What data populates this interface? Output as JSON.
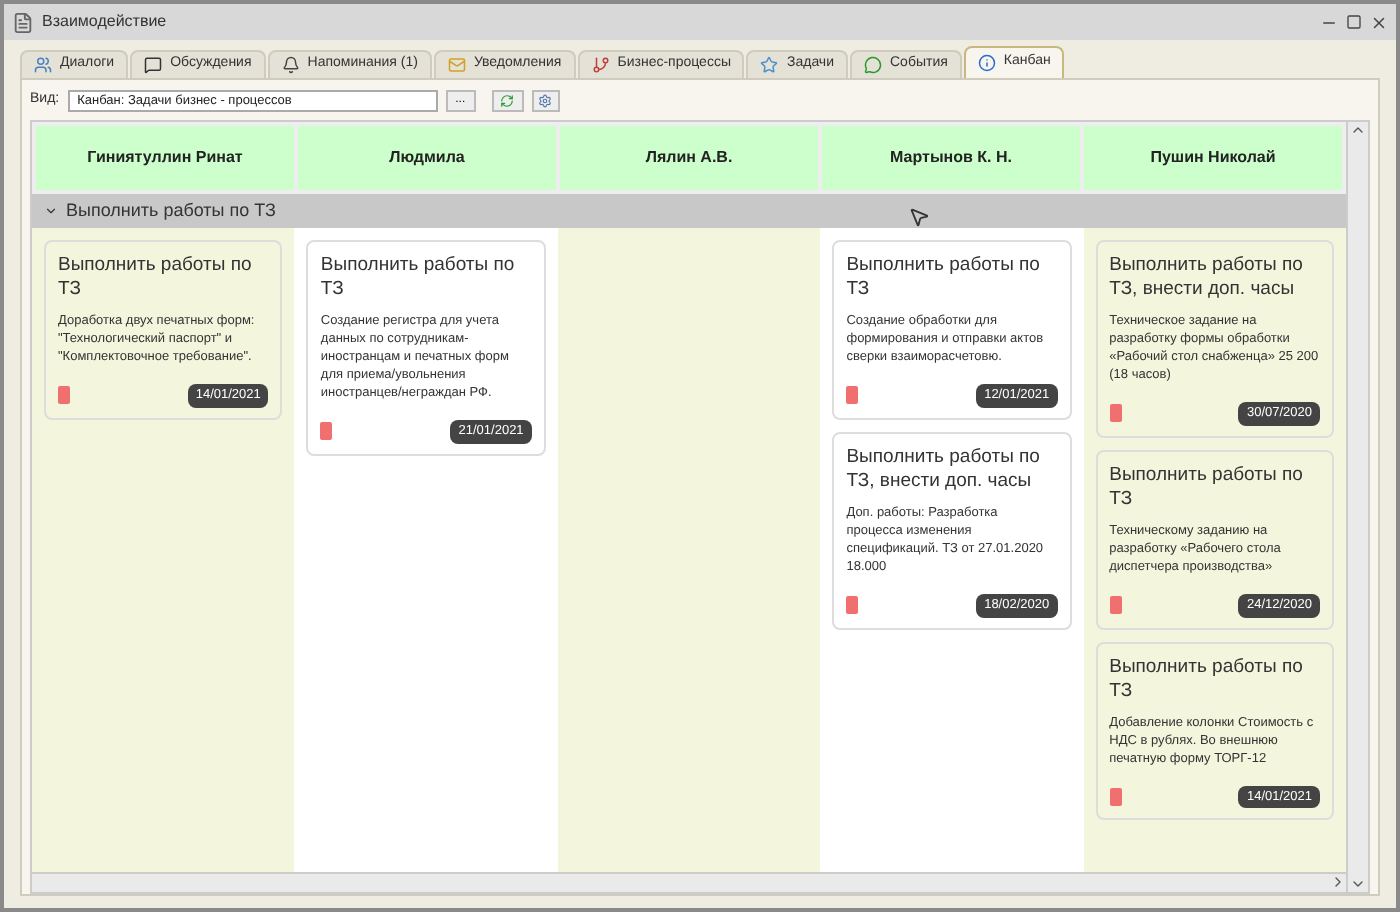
{
  "window": {
    "title": "Взаимодействие"
  },
  "tabs": [
    {
      "label": "Диалоги",
      "selected": false
    },
    {
      "label": "Обсуждения",
      "selected": false
    },
    {
      "label": "Напоминания (1)",
      "selected": false
    },
    {
      "label": "Уведомления",
      "selected": false
    },
    {
      "label": "Бизнес-процессы",
      "selected": false
    },
    {
      "label": "Задачи",
      "selected": false
    },
    {
      "label": "События",
      "selected": false
    },
    {
      "label": "Канбан",
      "selected": true
    }
  ],
  "view": {
    "label": "Вид:",
    "value": "Канбан: Задачи бизнес - процессов",
    "select_button": "..."
  },
  "board": {
    "columns": [
      {
        "name": "Гиниятуллин Ринат",
        "cards": [
          {
            "title": "Выполнить работы по ТЗ",
            "description": "Доработка двух печатных форм: \"Технологический паспорт\" и \"Комплектовочное требование\".",
            "date": "14/01/2021"
          }
        ]
      },
      {
        "name": "Людмила",
        "cards": [
          {
            "title": "Выполнить работы по ТЗ",
            "description": "Создание регистра для учета данных по сотрудникам-иностранцам и печатных форм для приема/увольнения иностранцев/неграждан РФ.",
            "date": "21/01/2021"
          }
        ]
      },
      {
        "name": "Лялин А.В."
      },
      {
        "name": "Мартынов К. Н.",
        "cards": [
          {
            "title": "Выполнить работы по ТЗ",
            "description": "Создание обработки для формирования и отправки актов сверки взаиморасчетовю.",
            "date": "12/01/2021"
          },
          {
            "title": "Выполнить работы по ТЗ, внести доп. часы",
            "description": "Доп. работы: Разработка процесса изменения спецификаций. ТЗ от 27.01.2020 18.000",
            "date": "18/02/2020"
          }
        ]
      },
      {
        "name": "Пушин Николай",
        "cards": [
          {
            "title": "Выполнить работы по ТЗ, внести доп. часы",
            "description": "Техническое задание на разработку формы обработки «Рабочий стол снабженца» 25 200 (18 часов)",
            "date": "30/07/2020"
          },
          {
            "title": "Выполнить работы по ТЗ",
            "description": "Техническому заданию на разработку «Рабочего стола диспетчера производства»",
            "date": "24/12/2020"
          },
          {
            "title": "Выполнить работы по ТЗ",
            "description": "Добавление колонки Стоимость с НДС в рублях. Во внешнюю печатную форму ТОРГ-12",
            "date": "14/01/2021"
          }
        ]
      }
    ],
    "group": {
      "title": "Выполнить работы по ТЗ",
      "expanded": true
    }
  }
}
